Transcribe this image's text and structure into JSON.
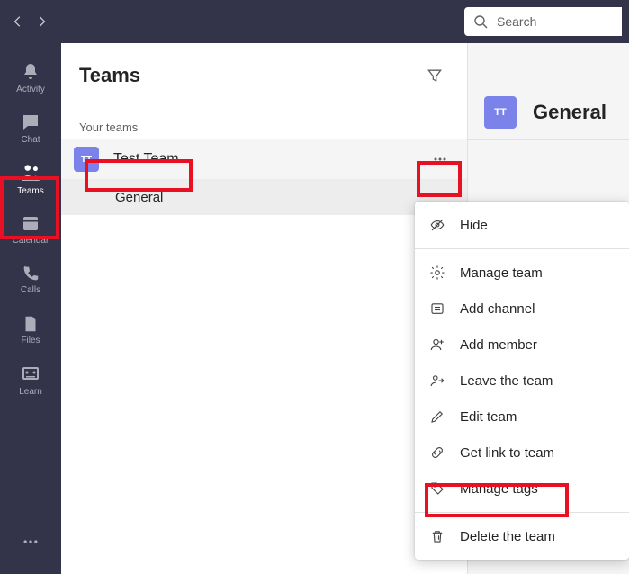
{
  "titlebar": {
    "search_placeholder": "Search"
  },
  "rail": {
    "items": [
      {
        "label": "Activity"
      },
      {
        "label": "Chat"
      },
      {
        "label": "Teams"
      },
      {
        "label": "Calendar"
      },
      {
        "label": "Calls"
      },
      {
        "label": "Files"
      },
      {
        "label": "Learn"
      }
    ]
  },
  "panel": {
    "title": "Teams",
    "section_label": "Your teams",
    "team": {
      "initials": "TT",
      "name": "Test Team"
    },
    "channel": "General"
  },
  "content": {
    "avatar_initials": "TT",
    "title": "General"
  },
  "menu": {
    "items": [
      {
        "label": "Hide"
      },
      {
        "label": "Manage team"
      },
      {
        "label": "Add channel"
      },
      {
        "label": "Add member"
      },
      {
        "label": "Leave the team"
      },
      {
        "label": "Edit team"
      },
      {
        "label": "Get link to team"
      },
      {
        "label": "Manage tags"
      },
      {
        "label": "Delete the team"
      }
    ]
  }
}
